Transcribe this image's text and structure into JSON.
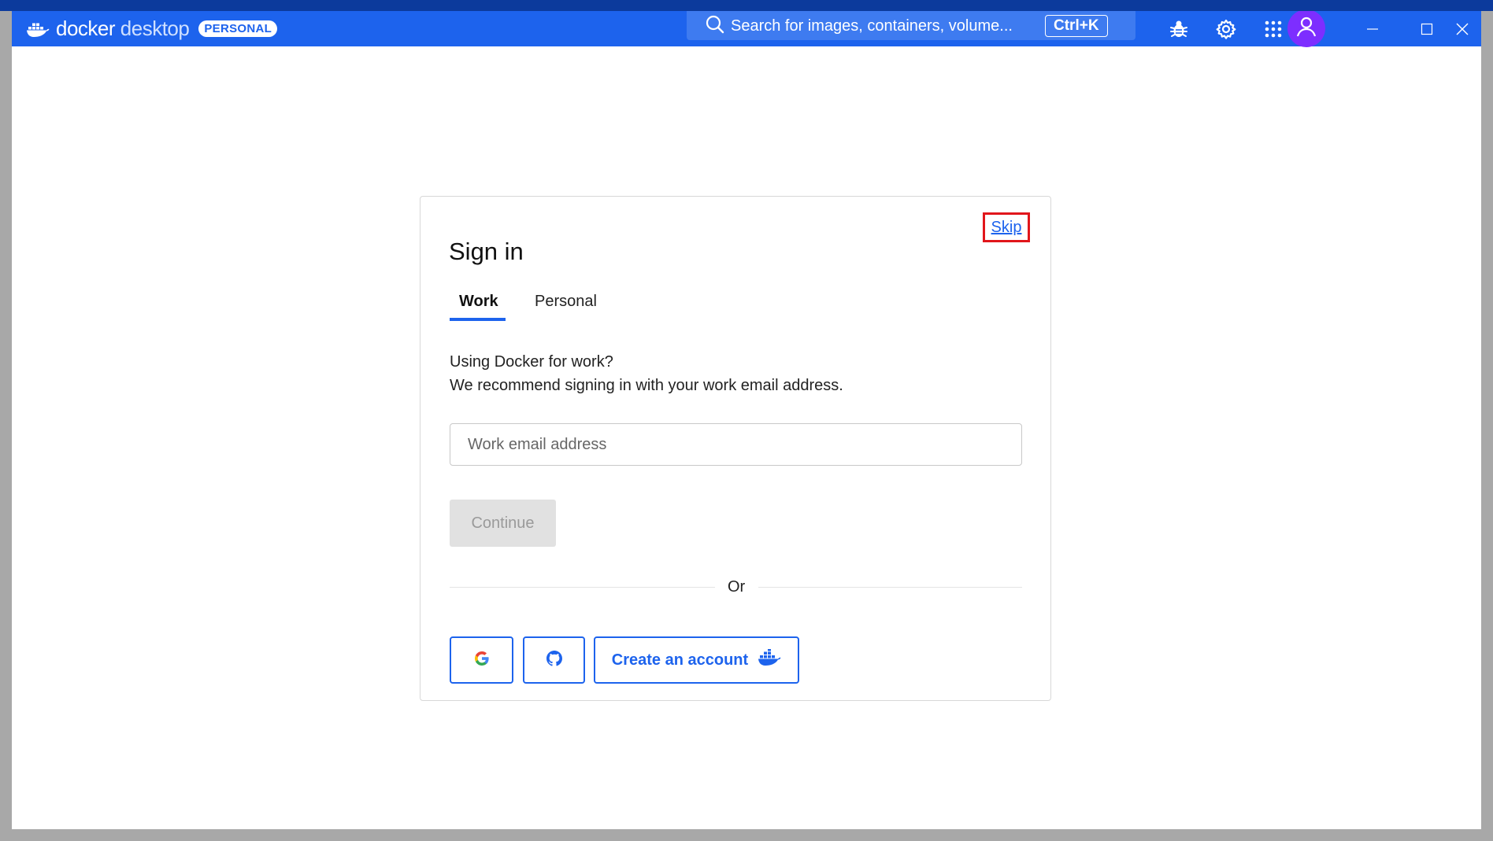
{
  "titlebar": {
    "app_name_primary": "docker",
    "app_name_secondary": "desktop",
    "plan_badge": "PERSONAL",
    "search_placeholder": "Search for images, containers, volume...",
    "search_shortcut": "Ctrl+K",
    "icons": [
      "docker-logo-icon",
      "search-icon",
      "bug-icon",
      "gear-icon",
      "apps-grid-icon",
      "user-icon",
      "minimize-icon",
      "maximize-icon",
      "close-icon"
    ]
  },
  "signin": {
    "title": "Sign in",
    "skip_label": "Skip",
    "tabs": [
      {
        "label": "Work",
        "active": true
      },
      {
        "label": "Personal",
        "active": false
      }
    ],
    "description_line1": "Using Docker for work?",
    "description_line2": "We recommend signing in with your work email address.",
    "email_placeholder": "Work email address",
    "email_value": "",
    "continue_label": "Continue",
    "divider_text": "Or",
    "create_account_label": "Create an account"
  },
  "colors": {
    "accent": "#1d63ed",
    "titlebar": "#1d63ed",
    "avatar": "#7d2eff",
    "highlight_box": "#e1161b",
    "disabled_button": "#e1e1e1"
  }
}
